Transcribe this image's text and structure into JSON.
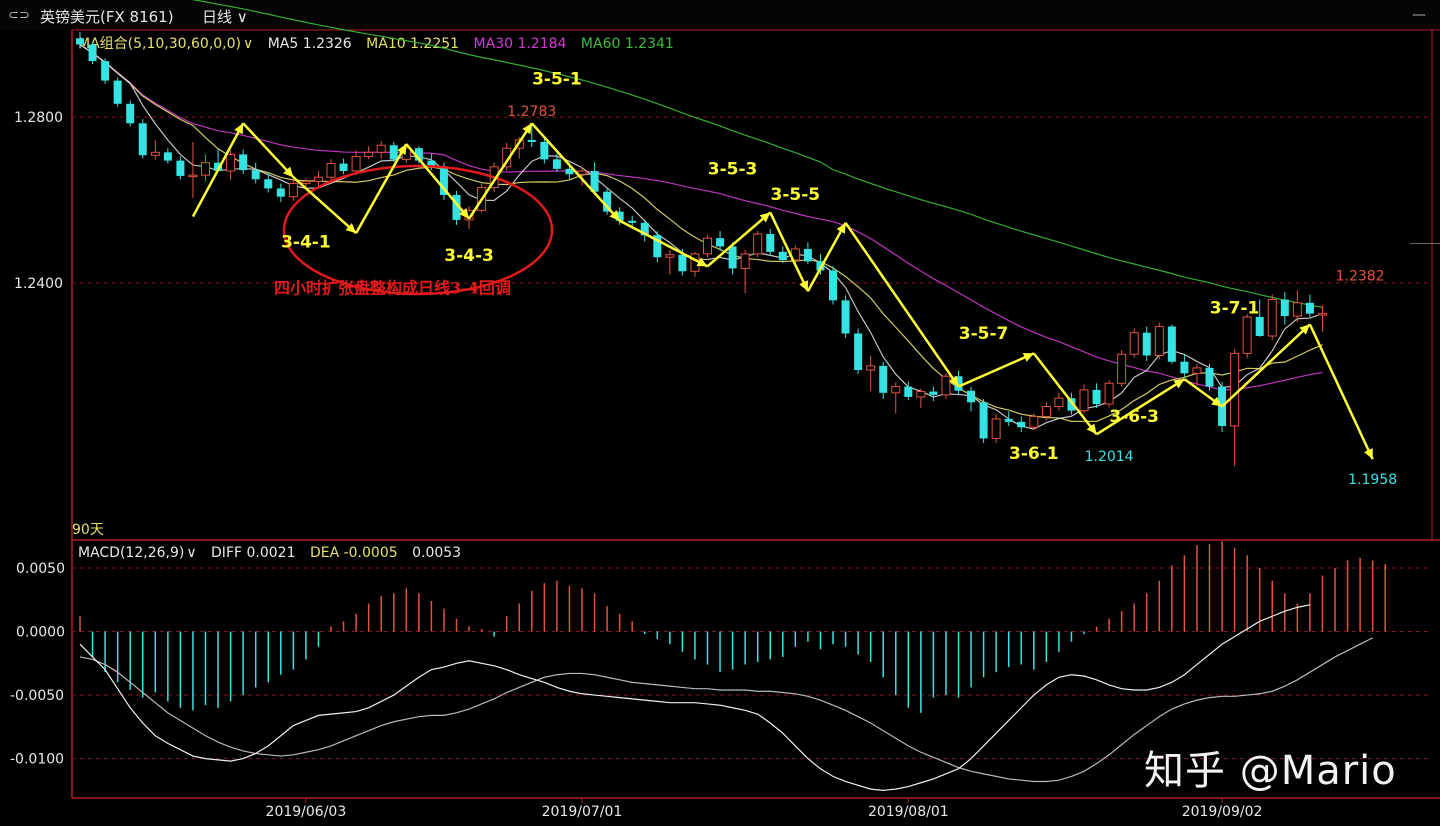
{
  "header": {
    "instrument": "英镑美元(FX 8161)",
    "period": "日线",
    "link_icon": "link-icon",
    "minimize_icon": "minimize-icon"
  },
  "legend_main": {
    "ma_group": "MA组合(5,10,30,60,0,0)",
    "ma5": "MA5 1.2326",
    "ma10": "MA10 1.2251",
    "ma30": "MA30 1.2184",
    "ma60": "MA60 1.2341"
  },
  "legend_macd": {
    "macd": "MACD(12,26,9)",
    "diff": "DIFF 0.0021",
    "dea": "DEA -0.0005",
    "macd_val": "0.0053"
  },
  "days_label": "90天",
  "watermark": "知乎 @Mario",
  "colors": {
    "up": "#e2533f",
    "down": "#35e3e3",
    "ma5": "#d8d8d8",
    "ma10": "#e7e06a",
    "ma30": "#d23ad2",
    "ma60": "#3bbf3b",
    "grid": "#7a1a1a",
    "axis": "#b02020",
    "annotation": "#ffff33",
    "note_red": "#e11b1b"
  },
  "chart_data": [
    {
      "type": "candlestick",
      "title": "英镑美元(FX 8161) 日线",
      "ylim": [
        1.178,
        1.301
      ],
      "y_ticks": [
        "1.2800",
        "1.2400"
      ],
      "x_ticks": [
        "2019/06/03",
        "2019/07/01",
        "2019/08/01",
        "2019/09/02"
      ],
      "price_labels": [
        {
          "text": "1.2783",
          "value": 1.2783,
          "kind": "high"
        },
        {
          "text": "1.2382",
          "value": 1.2382,
          "kind": "high"
        },
        {
          "text": "1.2014",
          "value": 1.2014,
          "kind": "low"
        },
        {
          "text": "1.1958",
          "value": 1.1958,
          "kind": "low"
        }
      ],
      "candles": [
        [
          1.299,
          1.3005,
          1.2965,
          1.2975
        ],
        [
          1.2975,
          1.2982,
          1.2928,
          1.2935
        ],
        [
          1.2935,
          1.2942,
          1.288,
          1.2888
        ],
        [
          1.2888,
          1.2895,
          1.2825,
          1.2832
        ],
        [
          1.2832,
          1.284,
          1.2778,
          1.2785
        ],
        [
          1.2785,
          1.2795,
          1.27,
          1.2708
        ],
        [
          1.2708,
          1.2745,
          1.2698,
          1.2715
        ],
        [
          1.2715,
          1.2725,
          1.2688,
          1.2695
        ],
        [
          1.2695,
          1.2705,
          1.265,
          1.2658
        ],
        [
          1.2658,
          1.274,
          1.2605,
          1.266
        ],
        [
          1.266,
          1.271,
          1.2645,
          1.269
        ],
        [
          1.269,
          1.2722,
          1.2668,
          1.267
        ],
        [
          1.267,
          1.272,
          1.2648,
          1.271
        ],
        [
          1.271,
          1.2722,
          1.2662,
          1.2672
        ],
        [
          1.2672,
          1.269,
          1.264,
          1.265
        ],
        [
          1.265,
          1.2665,
          1.2618,
          1.2628
        ],
        [
          1.2628,
          1.264,
          1.2595,
          1.2608
        ],
        [
          1.2608,
          1.265,
          1.2598,
          1.264
        ],
        [
          1.264,
          1.2652,
          1.2628,
          1.2645
        ],
        [
          1.2645,
          1.267,
          1.263,
          1.2655
        ],
        [
          1.2655,
          1.2698,
          1.2645,
          1.2688
        ],
        [
          1.2688,
          1.27,
          1.2662,
          1.267
        ],
        [
          1.267,
          1.272,
          1.266,
          1.2705
        ],
        [
          1.2705,
          1.273,
          1.2698,
          1.2715
        ],
        [
          1.2715,
          1.2742,
          1.27,
          1.2732
        ],
        [
          1.2732,
          1.274,
          1.2692,
          1.2698
        ],
        [
          1.2698,
          1.2735,
          1.269,
          1.2725
        ],
        [
          1.2725,
          1.273,
          1.2688,
          1.2695
        ],
        [
          1.2695,
          1.2712,
          1.2672,
          1.268
        ],
        [
          1.268,
          1.269,
          1.26,
          1.2612
        ],
        [
          1.2612,
          1.2622,
          1.254,
          1.2552
        ],
        [
          1.2552,
          1.2585,
          1.253,
          1.2575
        ],
        [
          1.2575,
          1.264,
          1.257,
          1.263
        ],
        [
          1.263,
          1.269,
          1.262,
          1.268
        ],
        [
          1.268,
          1.2738,
          1.267,
          1.2725
        ],
        [
          1.2725,
          1.2752,
          1.27,
          1.2745
        ],
        [
          1.2745,
          1.2783,
          1.2728,
          1.274
        ],
        [
          1.274,
          1.2748,
          1.2688,
          1.2698
        ],
        [
          1.2698,
          1.2712,
          1.2668,
          1.2675
        ],
        [
          1.2675,
          1.269,
          1.265,
          1.2662
        ],
        [
          1.2662,
          1.268,
          1.2635,
          1.267
        ],
        [
          1.267,
          1.269,
          1.2612,
          1.262
        ],
        [
          1.262,
          1.2628,
          1.2565,
          1.2572
        ],
        [
          1.2572,
          1.2582,
          1.254,
          1.255
        ],
        [
          1.255,
          1.2562,
          1.253,
          1.2545
        ],
        [
          1.2545,
          1.2552,
          1.25,
          1.2515
        ],
        [
          1.2515,
          1.2525,
          1.245,
          1.2462
        ],
        [
          1.2462,
          1.248,
          1.242,
          1.2468
        ],
        [
          1.2468,
          1.2482,
          1.2418,
          1.2428
        ],
        [
          1.2428,
          1.2475,
          1.2415,
          1.247
        ],
        [
          1.247,
          1.2515,
          1.2462,
          1.2508
        ],
        [
          1.2508,
          1.2525,
          1.2478,
          1.2488
        ],
        [
          1.2488,
          1.2498,
          1.242,
          1.2435
        ],
        [
          1.2435,
          1.248,
          1.2375,
          1.247
        ],
        [
          1.247,
          1.2525,
          1.2462,
          1.2518
        ],
        [
          1.2518,
          1.253,
          1.2465,
          1.2475
        ],
        [
          1.2475,
          1.2488,
          1.2448,
          1.2455
        ],
        [
          1.2455,
          1.249,
          1.244,
          1.2482
        ],
        [
          1.2482,
          1.2498,
          1.2445,
          1.2452
        ],
        [
          1.2452,
          1.247,
          1.242,
          1.243
        ],
        [
          1.243,
          1.244,
          1.2348,
          1.2358
        ],
        [
          1.2358,
          1.237,
          1.2268,
          1.2278
        ],
        [
          1.2278,
          1.229,
          1.218,
          1.219
        ],
        [
          1.219,
          1.2225,
          1.214,
          1.22
        ],
        [
          1.22,
          1.221,
          1.212,
          1.2135
        ],
        [
          1.2135,
          1.216,
          1.2085,
          1.215
        ],
        [
          1.215,
          1.2162,
          1.2118,
          1.2125
        ],
        [
          1.2125,
          1.2145,
          1.2098,
          1.2138
        ],
        [
          1.2138,
          1.215,
          1.2115,
          1.213
        ],
        [
          1.213,
          1.2182,
          1.212,
          1.2175
        ],
        [
          1.2175,
          1.2188,
          1.213,
          1.214
        ],
        [
          1.214,
          1.215,
          1.209,
          1.2112
        ],
        [
          1.2112,
          1.212,
          1.2014,
          1.2025
        ],
        [
          1.2025,
          1.2085,
          1.2014,
          1.2072
        ],
        [
          1.2072,
          1.209,
          1.2055,
          1.2065
        ],
        [
          1.2065,
          1.2078,
          1.204,
          1.2052
        ],
        [
          1.2052,
          1.2085,
          1.2045,
          1.2078
        ],
        [
          1.2078,
          1.2112,
          1.2068,
          1.2102
        ],
        [
          1.2102,
          1.2135,
          1.2092,
          1.2122
        ],
        [
          1.2122,
          1.2135,
          1.2082,
          1.2092
        ],
        [
          1.2092,
          1.2155,
          1.2085,
          1.2142
        ],
        [
          1.2142,
          1.2158,
          1.2098,
          1.2108
        ],
        [
          1.2108,
          1.2165,
          1.21,
          1.2158
        ],
        [
          1.2158,
          1.2238,
          1.215,
          1.2228
        ],
        [
          1.2228,
          1.229,
          1.222,
          1.228
        ],
        [
          1.228,
          1.2295,
          1.2212,
          1.2225
        ],
        [
          1.2225,
          1.2305,
          1.2215,
          1.2295
        ],
        [
          1.2295,
          1.23,
          1.2205,
          1.221
        ],
        [
          1.221,
          1.2228,
          1.2172,
          1.2182
        ],
        [
          1.2182,
          1.2205,
          1.2152,
          1.2195
        ],
        [
          1.2195,
          1.2205,
          1.214,
          1.215
        ],
        [
          1.215,
          1.2162,
          1.204,
          1.2055
        ],
        [
          1.2055,
          1.224,
          1.1958,
          1.223
        ],
        [
          1.223,
          1.2325,
          1.2218,
          1.2318
        ],
        [
          1.2318,
          1.236,
          1.227,
          1.2272
        ],
        [
          1.2272,
          1.2372,
          1.2262,
          1.236
        ],
        [
          1.236,
          1.2378,
          1.23,
          1.232
        ],
        [
          1.232,
          1.2382,
          1.2305,
          1.2352
        ],
        [
          1.2352,
          1.2372,
          1.2318,
          1.2326
        ],
        [
          1.2326,
          1.2345,
          1.2282,
          1.2326
        ]
      ],
      "ma_last": {
        "MA5": 1.2326,
        "MA10": 1.2251,
        "MA30": 1.2184,
        "MA60": 1.2341
      },
      "ma60_start": 1.308,
      "annotation_labels": [
        "3-4-1",
        "3-4-3",
        "3-5-1",
        "3-5-3",
        "3-5-5",
        "3-5-7",
        "3-6-1",
        "3-6-3",
        "3-7-1"
      ],
      "wave_path": [
        {
          "i": 9,
          "p": 1.256
        },
        {
          "i": 13,
          "p": 1.2785
        },
        {
          "i": 17,
          "p": 1.2655
        },
        {
          "i": 22,
          "p": 1.252
        },
        {
          "i": 26,
          "p": 1.2735
        },
        {
          "i": 31,
          "p": 1.2555
        },
        {
          "i": 36,
          "p": 1.2785
        },
        {
          "i": 43,
          "p": 1.255
        },
        {
          "i": 50,
          "p": 1.244
        },
        {
          "i": 55,
          "p": 1.257
        },
        {
          "i": 58,
          "p": 1.238
        },
        {
          "i": 61,
          "p": 1.2545
        },
        {
          "i": 70,
          "p": 1.215
        },
        {
          "i": 76,
          "p": 1.223
        },
        {
          "i": 81,
          "p": 1.2035
        },
        {
          "i": 88,
          "p": 1.2168
        },
        {
          "i": 91,
          "p": 1.2102
        },
        {
          "i": 98,
          "p": 1.23
        },
        {
          "i": 103,
          "p": 1.1975
        }
      ],
      "note": "四小时扩张盘整构成日线3-4回调"
    },
    {
      "type": "bar",
      "title": "MACD(12,26,9)",
      "ylim": [
        -0.0131,
        0.0072
      ],
      "y_ticks": [
        "0.0050",
        "0.0000",
        "-0.0050",
        "-0.0100"
      ],
      "histogram": [
        0.0012,
        -0.002,
        -0.0032,
        -0.004,
        -0.0046,
        -0.0052,
        -0.0048,
        -0.0055,
        -0.006,
        -0.0062,
        -0.0058,
        -0.006,
        -0.0055,
        -0.005,
        -0.0044,
        -0.004,
        -0.0034,
        -0.003,
        -0.0022,
        -0.0012,
        0.0004,
        0.0008,
        0.0014,
        0.0022,
        0.0028,
        0.003,
        0.0034,
        0.003,
        0.0024,
        0.0018,
        0.001,
        0.0004,
        0.0002,
        -0.0004,
        0.0012,
        0.0022,
        0.0032,
        0.0038,
        0.004,
        0.0036,
        0.0034,
        0.003,
        0.002,
        0.0014,
        0.0008,
        -0.0002,
        -0.0006,
        -0.001,
        -0.0016,
        -0.0022,
        -0.0026,
        -0.0032,
        -0.003,
        -0.0026,
        -0.0024,
        -0.0022,
        -0.002,
        -0.0012,
        -0.0008,
        -0.0014,
        -0.001,
        -0.0012,
        -0.0018,
        -0.0024,
        -0.0036,
        -0.005,
        -0.006,
        -0.0064,
        -0.0052,
        -0.005,
        -0.0052,
        -0.0044,
        -0.0036,
        -0.0032,
        -0.0028,
        -0.0026,
        -0.003,
        -0.0024,
        -0.0016,
        -0.0008,
        -0.0002,
        0.0004,
        0.001,
        0.0016,
        0.0022,
        0.003,
        0.004,
        0.0052,
        0.006,
        0.0068,
        0.0069,
        0.0071,
        0.0066,
        0.006,
        0.005,
        0.004,
        0.003,
        0.0022,
        0.003,
        0.0044,
        0.005,
        0.0056,
        0.0058,
        0.0056,
        0.0053
      ],
      "dea": [
        -0.002,
        -0.0022,
        -0.0026,
        -0.0032,
        -0.004,
        -0.0048,
        -0.0056,
        -0.0064,
        -0.007,
        -0.0076,
        -0.0082,
        -0.0087,
        -0.0091,
        -0.0094,
        -0.0096,
        -0.0097,
        -0.0098,
        -0.0097,
        -0.0095,
        -0.0093,
        -0.009,
        -0.0086,
        -0.0082,
        -0.0078,
        -0.0074,
        -0.0071,
        -0.0069,
        -0.0067,
        -0.0066,
        -0.0066,
        -0.0064,
        -0.0061,
        -0.0057,
        -0.0053,
        -0.0048,
        -0.0044,
        -0.004,
        -0.0036,
        -0.0034,
        -0.0033,
        -0.0033,
        -0.0034,
        -0.0036,
        -0.0038,
        -0.004,
        -0.0041,
        -0.0042,
        -0.0043,
        -0.0044,
        -0.0045,
        -0.0045,
        -0.0046,
        -0.0046,
        -0.0046,
        -0.0047,
        -0.0047,
        -0.0048,
        -0.0049,
        -0.0051,
        -0.0054,
        -0.0058,
        -0.0062,
        -0.0067,
        -0.0072,
        -0.0078,
        -0.0084,
        -0.009,
        -0.0095,
        -0.0099,
        -0.0103,
        -0.0107,
        -0.011,
        -0.0112,
        -0.0114,
        -0.0116,
        -0.0117,
        -0.0118,
        -0.0118,
        -0.0117,
        -0.0114,
        -0.011,
        -0.0104,
        -0.0097,
        -0.0089,
        -0.0081,
        -0.0074,
        -0.0067,
        -0.0061,
        -0.0057,
        -0.0054,
        -0.0052,
        -0.0051,
        -0.0051,
        -0.005,
        -0.0049,
        -0.0047,
        -0.0043,
        -0.0038,
        -0.0032,
        -0.0026,
        -0.002,
        -0.0015,
        -0.001,
        -0.0005
      ],
      "diff": [
        -0.001,
        -0.002,
        -0.003,
        -0.0045,
        -0.006,
        -0.0072,
        -0.0082,
        -0.0088,
        -0.0093,
        -0.0098,
        -0.01,
        -0.0101,
        -0.0102,
        -0.01,
        -0.0096,
        -0.009,
        -0.0082,
        -0.0074,
        -0.007,
        -0.0066,
        -0.0065,
        -0.0064,
        -0.0063,
        -0.006,
        -0.0055,
        -0.005,
        -0.0043,
        -0.0036,
        -0.003,
        -0.0028,
        -0.0025,
        -0.0023,
        -0.0025,
        -0.0027,
        -0.003,
        -0.0034,
        -0.0037,
        -0.004,
        -0.0044,
        -0.0047,
        -0.0049,
        -0.005,
        -0.0051,
        -0.0052,
        -0.0053,
        -0.0054,
        -0.0055,
        -0.0056,
        -0.0056,
        -0.0056,
        -0.0057,
        -0.0058,
        -0.006,
        -0.0062,
        -0.0065,
        -0.0072,
        -0.008,
        -0.009,
        -0.01,
        -0.0108,
        -0.0114,
        -0.0118,
        -0.0121,
        -0.0124,
        -0.0125,
        -0.0124,
        -0.0122,
        -0.0119,
        -0.0116,
        -0.0112,
        -0.0108,
        -0.01,
        -0.009,
        -0.008,
        -0.007,
        -0.006,
        -0.005,
        -0.0042,
        -0.0036,
        -0.0034,
        -0.0035,
        -0.0038,
        -0.0042,
        -0.0045,
        -0.0046,
        -0.0046,
        -0.0044,
        -0.004,
        -0.0034,
        -0.0026,
        -0.0018,
        -0.001,
        -0.0004,
        0.0002,
        0.0008,
        0.0012,
        0.0016,
        0.0019,
        0.0021
      ]
    }
  ]
}
